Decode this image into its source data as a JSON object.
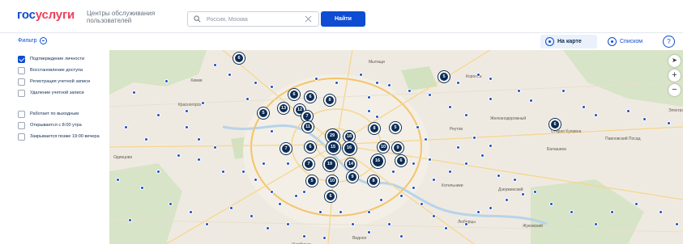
{
  "header": {
    "logo_part1": "гос",
    "logo_part2": "услуги",
    "title": "Центры обслуживания пользователей",
    "search_placeholder": "Россия, Москва",
    "find_label": "Найти"
  },
  "subbar": {
    "filter_label": "Фильтр",
    "map_view_label": "На карте",
    "list_view_label": "Списком",
    "help_label": "?"
  },
  "filters": [
    {
      "label": "Подтверждение личности",
      "checked": true
    },
    {
      "label": "Восстановление доступа",
      "checked": false
    },
    {
      "label": "Регистрация учетной записи",
      "checked": false
    },
    {
      "label": "Удаление учетной записи",
      "checked": false
    },
    {
      "label": "Работает по выходным",
      "checked": false
    },
    {
      "label": "Открывается с 8:00 утра",
      "checked": false
    },
    {
      "label": "Закрывается позже 19:00 вечера",
      "checked": false
    }
  ],
  "map": {
    "labels": [
      "Химки",
      "Мытищи",
      "Королёв",
      "Балашиха",
      "Реутов",
      "Люберцы",
      "Железнодорожный",
      "Электроугли",
      "Старая Купавна",
      "Павловский Посад",
      "Одинцово",
      "Красногорск",
      "Видное",
      "Дзержинский",
      "Жуковский",
      "Котельники",
      "Щербинка"
    ],
    "clusters": [
      "6",
      "5",
      "6",
      "6",
      "8",
      "12",
      "13",
      "7",
      "5",
      "11",
      "29",
      "18",
      "8",
      "5",
      "7",
      "6",
      "15",
      "16",
      "10",
      "9",
      "7",
      "19",
      "14",
      "16",
      "6",
      "5",
      "10",
      "9",
      "8",
      "6",
      "6"
    ],
    "zoom_in": "+",
    "zoom_out": "−"
  },
  "colors": {
    "brand_blue": "#0d4cd3",
    "brand_red": "#ee3f58",
    "cluster": "#0d2c54",
    "map_bg": "#efeae1"
  }
}
